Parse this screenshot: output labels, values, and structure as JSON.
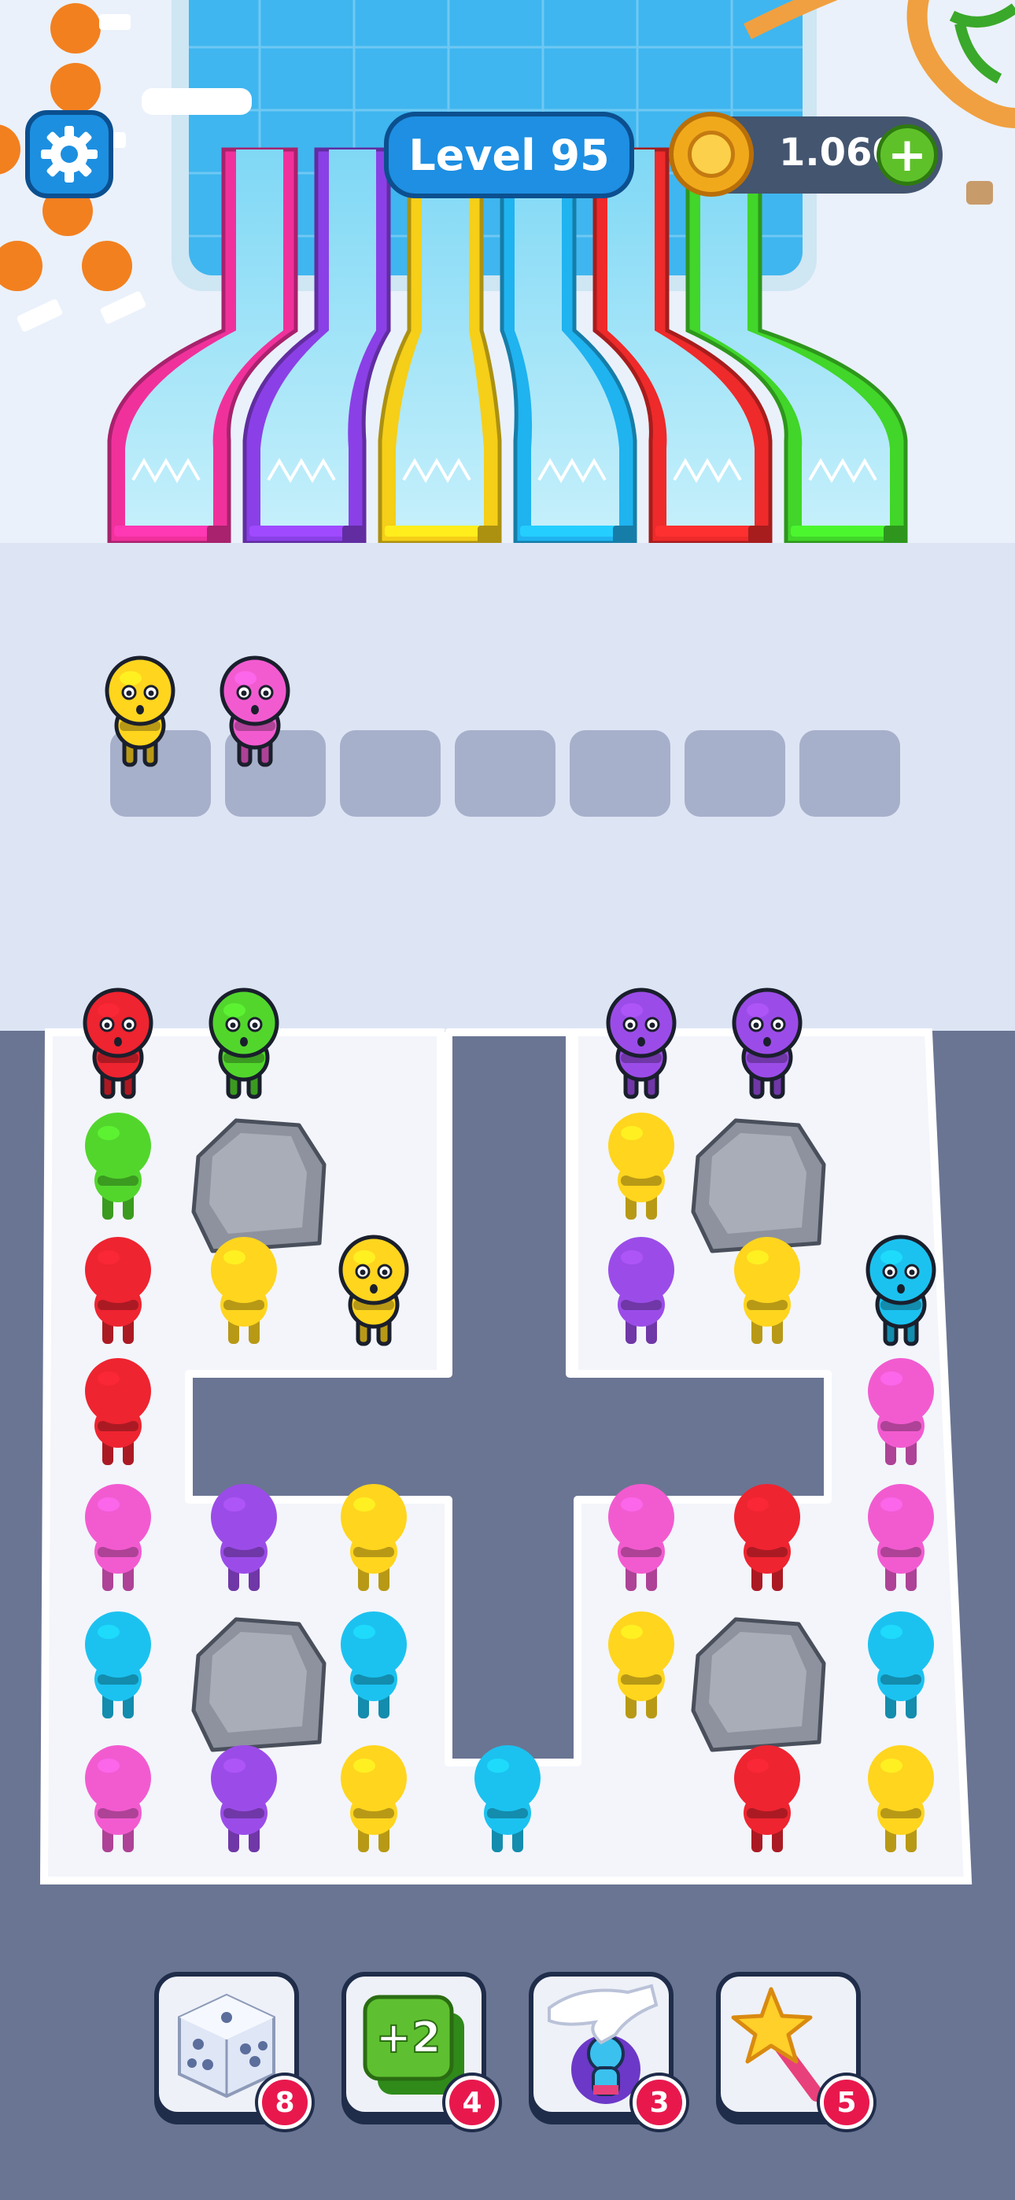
{
  "hud": {
    "level_label": "Level 95",
    "coins": "1.060",
    "settings_icon": "gear-icon",
    "add_coins_icon": "plus-icon",
    "coin_icon": "coin-icon"
  },
  "slides": [
    {
      "color": "pink",
      "hex": "#f0319c"
    },
    {
      "color": "purple",
      "hex": "#8a40e6"
    },
    {
      "color": "yellow",
      "hex": "#f5cf18"
    },
    {
      "color": "blue",
      "hex": "#1fb3f0"
    },
    {
      "color": "red",
      "hex": "#ee2a2a"
    },
    {
      "color": "green",
      "hex": "#41d629"
    }
  ],
  "waiting_slots": {
    "total": 7,
    "occupied": [
      "yellow",
      "pink"
    ]
  },
  "grid_people": [
    {
      "row": 0,
      "col": 0,
      "color": "red",
      "active": true
    },
    {
      "row": 0,
      "col": 1,
      "color": "green",
      "active": true
    },
    {
      "row": 0,
      "col": 4,
      "color": "purple",
      "active": true
    },
    {
      "row": 0,
      "col": 5,
      "color": "purple",
      "active": true
    },
    {
      "row": 1,
      "col": 0,
      "color": "green",
      "active": false
    },
    {
      "row": 1,
      "col": 4,
      "color": "yellow",
      "active": false
    },
    {
      "row": 2,
      "col": 0,
      "color": "red",
      "active": false
    },
    {
      "row": 2,
      "col": 1,
      "color": "yellow",
      "active": false
    },
    {
      "row": 2,
      "col": 2,
      "color": "yellow",
      "active": true
    },
    {
      "row": 2,
      "col": 4,
      "color": "purple",
      "active": false
    },
    {
      "row": 2,
      "col": 5,
      "color": "yellow",
      "active": false
    },
    {
      "row": 2,
      "col": 6,
      "color": "blue",
      "active": true
    },
    {
      "row": 3,
      "col": 0,
      "color": "red",
      "active": false
    },
    {
      "row": 3,
      "col": 6,
      "color": "pink",
      "active": false
    },
    {
      "row": 4,
      "col": 0,
      "color": "pink",
      "active": false
    },
    {
      "row": 4,
      "col": 1,
      "color": "purple",
      "active": false
    },
    {
      "row": 4,
      "col": 2,
      "color": "yellow",
      "active": false
    },
    {
      "row": 4,
      "col": 4,
      "color": "pink",
      "active": false
    },
    {
      "row": 4,
      "col": 5,
      "color": "red",
      "active": false
    },
    {
      "row": 4,
      "col": 6,
      "color": "pink",
      "active": false
    },
    {
      "row": 5,
      "col": 0,
      "color": "blue",
      "active": false
    },
    {
      "row": 5,
      "col": 2,
      "color": "blue",
      "active": false
    },
    {
      "row": 5,
      "col": 4,
      "color": "yellow",
      "active": false
    },
    {
      "row": 5,
      "col": 6,
      "color": "blue",
      "active": false
    },
    {
      "row": 6,
      "col": 0,
      "color": "pink",
      "active": false
    },
    {
      "row": 6,
      "col": 1,
      "color": "purple",
      "active": false
    },
    {
      "row": 6,
      "col": 2,
      "color": "yellow",
      "active": false
    },
    {
      "row": 6,
      "col": 3,
      "color": "blue",
      "active": false
    },
    {
      "row": 6,
      "col": 5,
      "color": "red",
      "active": false
    },
    {
      "row": 6,
      "col": 6,
      "color": "yellow",
      "active": false
    }
  ],
  "rocks": [
    {
      "row": 1,
      "col": 1
    },
    {
      "row": 1,
      "col": 5
    },
    {
      "row": 5,
      "col": 1
    },
    {
      "row": 5,
      "col": 5
    }
  ],
  "palette": {
    "red": "#ee2430",
    "green": "#52d62c",
    "purple": "#9b4ce8",
    "yellow": "#ffd51e",
    "pink": "#f25bd0",
    "blue": "#1bc2f0"
  },
  "boosters": [
    {
      "name": "shuffle",
      "icon": "dice-icon",
      "count": "8"
    },
    {
      "name": "extra-slots",
      "icon": "plus-two-icon",
      "label": "+2",
      "count": "4"
    },
    {
      "name": "pick-person",
      "icon": "grab-hand-icon",
      "count": "3"
    },
    {
      "name": "magic-wand",
      "icon": "star-wand-icon",
      "count": "5"
    }
  ]
}
